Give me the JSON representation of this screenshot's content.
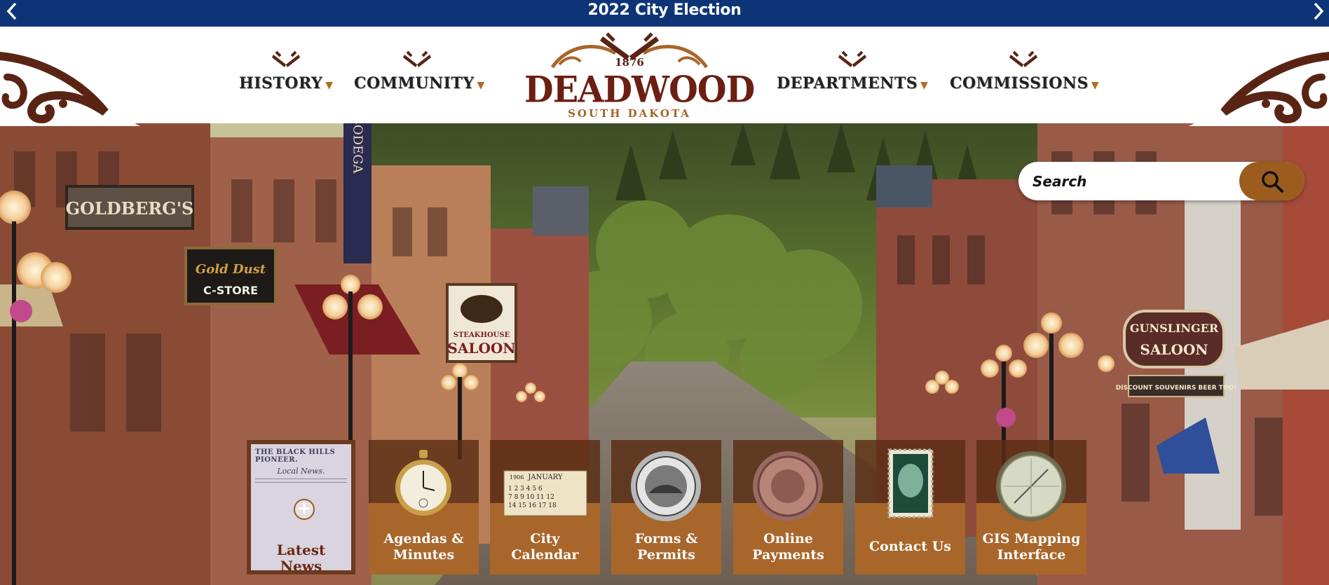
{
  "alert": {
    "title": "2022 City Election"
  },
  "nav": {
    "items": [
      {
        "label": "HISTORY",
        "caret": "▼"
      },
      {
        "label": "COMMUNITY",
        "caret": "▼"
      },
      {
        "label": "DEPARTMENTS",
        "caret": "▼"
      },
      {
        "label": "COMMISSIONS",
        "caret": "▼"
      }
    ]
  },
  "logo": {
    "year": "1876",
    "name": "DEADWOOD",
    "subtitle": "SOUTH DAKOTA"
  },
  "search": {
    "placeholder": "Search",
    "icon": "search-icon"
  },
  "hero": {
    "signs": {
      "goldbergs": "GOLDBERG'S",
      "bodega": "BODEGA",
      "gold_dust": "Gold Dust",
      "c_store": "C-STORE",
      "steakhouse": "STEAKHOUSE",
      "saloon": "SALOON",
      "gunslinger": "GUNSLINGER",
      "gunslinger_saloon": "SALOON",
      "souvenirs": "DISCOUNT SOUVENIRS BEER TOO!"
    }
  },
  "tiles": [
    {
      "label": "Latest News",
      "paper_title": "THE BLACK HILLS PIONEER.",
      "paper_sub": "Local News.",
      "plus": "+",
      "icon": "newspaper-icon"
    },
    {
      "label_line1": "Agendas &",
      "label_line2": "Minutes",
      "icon": "pocket-watch-icon"
    },
    {
      "label_line1": "City",
      "label_line2": "Calendar",
      "icon": "calendar-icon",
      "cal_month": "JANUARY",
      "cal_year": "1906"
    },
    {
      "label_line1": "Forms &",
      "label_line2": "Permits",
      "icon": "city-seal-icon"
    },
    {
      "label_line1": "Online",
      "label_line2": "Payments",
      "icon": "coin-icon"
    },
    {
      "label_line1": "Contact Us",
      "label_line2": "",
      "icon": "stamp-icon"
    },
    {
      "label_line1": "GIS Mapping",
      "label_line2": "Interface",
      "icon": "compass-icon"
    }
  ],
  "colors": {
    "alert_bg": "#0d3477",
    "brand_brown": "#6b1f13",
    "accent_copper": "#a8662b",
    "tile_dark": "#5a2d14"
  }
}
